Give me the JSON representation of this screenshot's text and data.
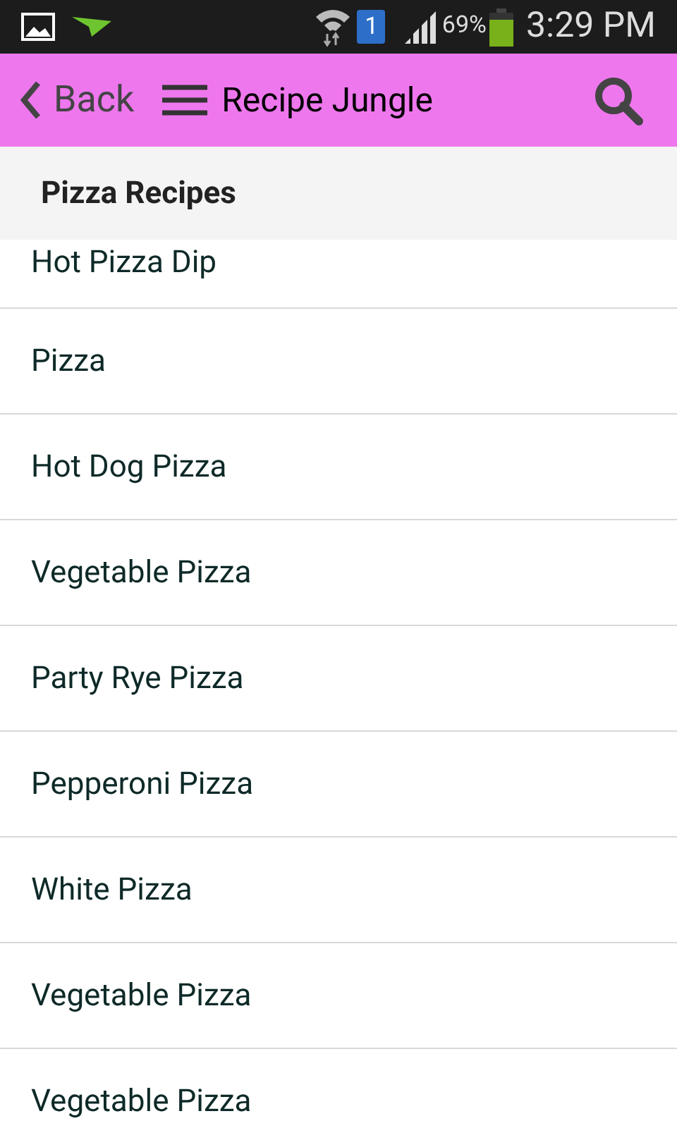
{
  "status_bar": {
    "sim_badge": "1",
    "battery_percent": "69%",
    "time": "3:29 PM"
  },
  "app_bar": {
    "back": "Back",
    "title": "Recipe Jungle"
  },
  "section": {
    "title": "Pizza Recipes"
  },
  "recipes": [
    "Hot Pizza Dip",
    "Pizza",
    "Hot Dog Pizza",
    "Vegetable Pizza",
    "Party Rye Pizza",
    "Pepperoni Pizza",
    "White Pizza",
    "Vegetable Pizza",
    "Vegetable Pizza"
  ]
}
